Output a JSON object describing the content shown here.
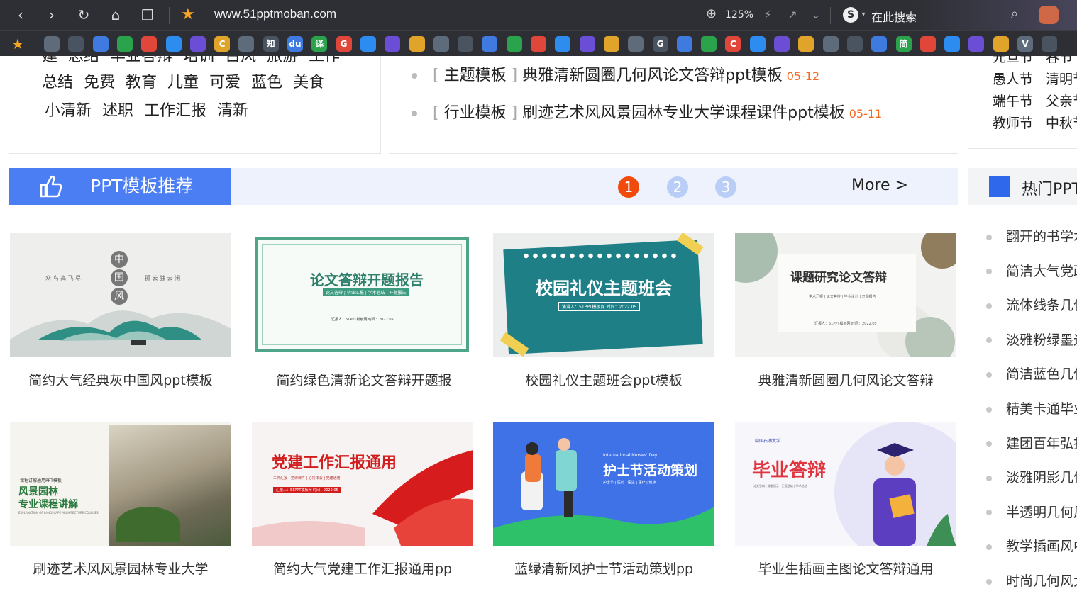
{
  "browser": {
    "url": "www.51pptmoban.com",
    "zoom": "125%",
    "search_placeholder": "在此搜索",
    "search_engine_letter": "S"
  },
  "bookmarks": {
    "letters": [
      "",
      "",
      "",
      "",
      "",
      "",
      "",
      "C",
      "",
      "知",
      "du",
      "译",
      "G",
      "",
      "",
      "",
      "",
      "",
      "",
      "",
      "",
      "",
      "",
      "",
      "",
      "G",
      "",
      "",
      "C",
      "",
      "",
      "",
      "",
      "",
      "",
      "简",
      "",
      "",
      "",
      "",
      "V",
      ""
    ]
  },
  "tags": {
    "row0": [
      "建",
      "总结",
      "毕业答辩",
      "培训",
      "古风",
      "旅游",
      "工作"
    ],
    "row1": [
      "总结",
      "免费",
      "教育",
      "儿童",
      "可爱",
      "蓝色",
      "美食"
    ],
    "row2": [
      "小清新",
      "述职",
      "工作汇报",
      "清新"
    ]
  },
  "news": [
    {
      "category": "主题模板",
      "title": "典雅清新圆圈几何风论文答辩ppt模板",
      "date": "05-12"
    },
    {
      "category": "行业模板",
      "title": "刷迹艺术风风景园林专业大学课程课件ppt模板",
      "date": "05-11"
    }
  ],
  "festivals": {
    "row0": [
      "元旦节",
      "春节"
    ],
    "row1": [
      "愚人节",
      "清明节"
    ],
    "row2": [
      "端午节",
      "父亲节"
    ],
    "row3": [
      "教师节",
      "中秋节"
    ]
  },
  "section": {
    "title": "PPT模板推荐",
    "pages": [
      "1",
      "2",
      "3"
    ],
    "more": "More >"
  },
  "cards": [
    {
      "caption": "简约大气经典灰中国风ppt模板",
      "thumb_lines": [
        "中",
        "国",
        "风"
      ],
      "thumb_sub": "众 鸟 高 飞 尽",
      "thumb_sub2": "孤 云 独 去 闲"
    },
    {
      "caption": "简约绿色清新论文答辩开题报",
      "thumb_lines": [
        "论文答辩开题报告"
      ],
      "thumb_sub": "论文答辩 | 毕业汇报 | 学术总结 | 开题报告",
      "thumb_sub2": "汇报人：51PPT模板网    时间：2022.05"
    },
    {
      "caption": "校园礼仪主题班会ppt模板",
      "thumb_lines": [
        "校园礼仪主题班会"
      ],
      "thumb_sub": "演讲人：51PPT模板网    时间：2022.05",
      "thumb_sub2": ""
    },
    {
      "caption": "典雅清新圆圈几何风论文答辩",
      "thumb_lines": [
        "课题研究论文答辩"
      ],
      "thumb_sub": "学术汇报 | 论文答辩 | 毕业设计 | 开题报告",
      "thumb_sub2": "汇报人：51PPT模板网    时间：2022.05"
    },
    {
      "caption": "刷迹艺术风风景园林专业大学",
      "thumb_lines": [
        "风景园林",
        "专业课程讲解"
      ],
      "thumb_sub": "课程讲解通用PPT模板",
      "thumb_sub2": "EXPLANATION OF LANDSCAPE ARCHITECTURE COURSES"
    },
    {
      "caption": "简约大气党建工作汇报通用pp",
      "thumb_lines": [
        "党建工作汇报通用"
      ],
      "thumb_sub": "工作汇报 | 党课课件 | 心得体会 | 党建通用",
      "thumb_sub2": "汇报人：51PPT模板网    时间：2022.05"
    },
    {
      "caption": "蓝绿清新风护士节活动策划pp",
      "thumb_lines": [
        "护士节活动策划"
      ],
      "thumb_sub": "International Nurses' Day",
      "thumb_sub2": "护士节 | 医药 | 医生 | 医疗 | 健康"
    },
    {
      "caption": "毕业生插画主图论文答辩通用",
      "thumb_lines": [
        "毕业答辩"
      ],
      "thumb_sub": "中国石油大学",
      "thumb_sub2": "论文答辩 | 课堂演示 | 汇报总结 | 学术总结"
    }
  ],
  "hot": {
    "title": "热门PPT",
    "items": [
      "翻开的书学术",
      "简洁大气党政",
      "流体线条几何",
      "淡雅粉绿墨迹",
      "简洁蓝色几何",
      "精美卡通毕业",
      "建团百年弘扬",
      "淡雅阴影几何",
      "半透明几何风",
      "教学插画风中",
      "时尚几何风大"
    ]
  },
  "colors": {
    "accent_blue": "#4c7ef3",
    "page_active": "#f04a0c",
    "date_orange": "#f26a22"
  }
}
